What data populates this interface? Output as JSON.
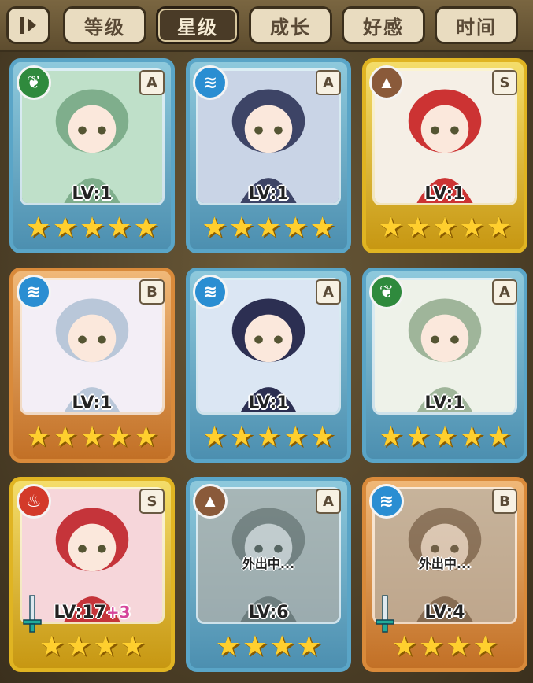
{
  "tabs": [
    {
      "label": "等级",
      "active": false
    },
    {
      "label": "星级",
      "active": true
    },
    {
      "label": "成长",
      "active": false
    },
    {
      "label": "好感",
      "active": false
    },
    {
      "label": "时间",
      "active": false
    }
  ],
  "cards": [
    {
      "element": "grass-icon",
      "grade": "A",
      "level": "LV:1",
      "bonus": "",
      "stars": 5,
      "away_label": ""
    },
    {
      "element": "water-icon",
      "grade": "A",
      "level": "LV:1",
      "bonus": "",
      "stars": 5,
      "away_label": ""
    },
    {
      "element": "earth-icon",
      "grade": "S",
      "level": "LV:1",
      "bonus": "",
      "stars": 5,
      "away_label": ""
    },
    {
      "element": "water-icon",
      "grade": "B",
      "level": "LV:1",
      "bonus": "",
      "stars": 5,
      "away_label": ""
    },
    {
      "element": "water-icon",
      "grade": "A",
      "level": "LV:1",
      "bonus": "",
      "stars": 5,
      "away_label": ""
    },
    {
      "element": "grass-icon",
      "grade": "A",
      "level": "LV:1",
      "bonus": "",
      "stars": 5,
      "away_label": ""
    },
    {
      "element": "fire-icon",
      "grade": "S",
      "level": "LV:17",
      "bonus": "+3",
      "stars": 4,
      "away_label": ""
    },
    {
      "element": "earth-icon",
      "grade": "A",
      "level": "LV:6",
      "bonus": "",
      "stars": 4,
      "away_label": "外出中..."
    },
    {
      "element": "water-icon",
      "grade": "B",
      "level": "LV:4",
      "bonus": "",
      "stars": 4,
      "away_label": "外出中..."
    }
  ]
}
